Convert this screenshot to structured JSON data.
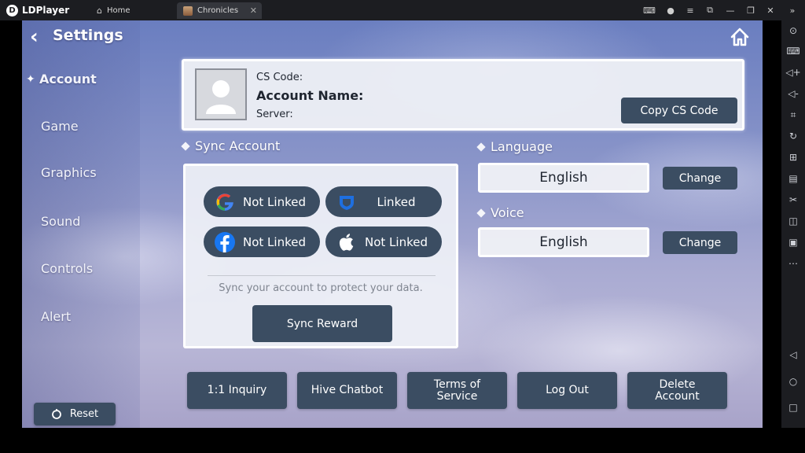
{
  "emulator": {
    "brand": "LDPlayer",
    "tabs": [
      {
        "label": "Home"
      },
      {
        "label": "Chronicles"
      }
    ]
  },
  "header": {
    "title": "Settings"
  },
  "nav": {
    "items": [
      {
        "label": "Account"
      },
      {
        "label": "Game"
      },
      {
        "label": "Graphics"
      },
      {
        "label": "Sound"
      },
      {
        "label": "Controls"
      },
      {
        "label": "Alert"
      }
    ],
    "reset_label": "Reset"
  },
  "account": {
    "cs_code_label": "CS Code:",
    "account_name_label": "Account Name:",
    "server_label": "Server:",
    "copy_button": "Copy CS Code"
  },
  "sync": {
    "section_label": "Sync Account",
    "providers": [
      {
        "icon": "google-icon",
        "status": "Not Linked"
      },
      {
        "icon": "hive-icon",
        "status": "Linked"
      },
      {
        "icon": "facebook-icon",
        "status": "Not Linked"
      },
      {
        "icon": "apple-icon",
        "status": "Not Linked"
      }
    ],
    "hint": "Sync your account to protect your data.",
    "reward_button": "Sync Reward"
  },
  "language": {
    "section_label": "Language",
    "value": "English",
    "change_button": "Change"
  },
  "voice": {
    "section_label": "Voice",
    "value": "English",
    "change_button": "Change"
  },
  "actions": [
    {
      "label": "1:1 Inquiry"
    },
    {
      "label": "Hive Chatbot"
    },
    {
      "label": "Terms of Service"
    },
    {
      "label": "Log Out"
    },
    {
      "label": "Delete Account"
    }
  ],
  "colors": {
    "button": "#3b4d62",
    "card": "#eef0f6",
    "google_blue": "#4285f4",
    "facebook_blue": "#1877f2",
    "hive_blue": "#1e6fe0"
  }
}
